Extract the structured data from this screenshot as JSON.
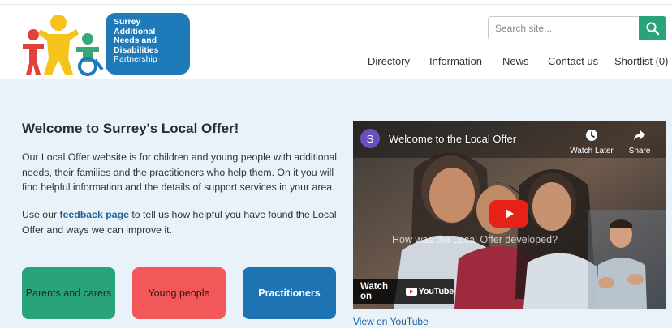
{
  "logo": {
    "lines": [
      "Surrey",
      "Additional",
      "Needs and",
      "Disabilities"
    ],
    "sub": "Partnership"
  },
  "search": {
    "placeholder": "Search site..."
  },
  "nav": {
    "items": [
      "Directory",
      "Information",
      "News",
      "Contact us",
      "Shortlist (0)"
    ]
  },
  "main": {
    "title": "Welcome to Surrey's Local Offer!",
    "intro": "Our Local Offer website is for children and young people with additional needs, their families and the practitioners who help them. On it you will find helpful information and the details of support services in your area.",
    "feedback_pre": "Use our ",
    "feedback_link": "feedback page",
    "feedback_post": " to tell us how helpful you have found the Local Offer and ways we can improve it."
  },
  "tiles": [
    "Parents and carers",
    "Young people",
    "Practitioners"
  ],
  "video": {
    "channel_initial": "S",
    "title": "Welcome to the Local Offer",
    "watch_later": "Watch Later",
    "share": "Share",
    "caption": "How was the Local Offer developed?",
    "watch_on": "Watch on",
    "youtube": "YouTube",
    "view_on_youtube": "View on YouTube"
  },
  "colors": {
    "brand_blue": "#1e7ab8",
    "green": "#2aa37a",
    "coral": "#f2585a",
    "panel_bg": "#e9f2f9"
  }
}
